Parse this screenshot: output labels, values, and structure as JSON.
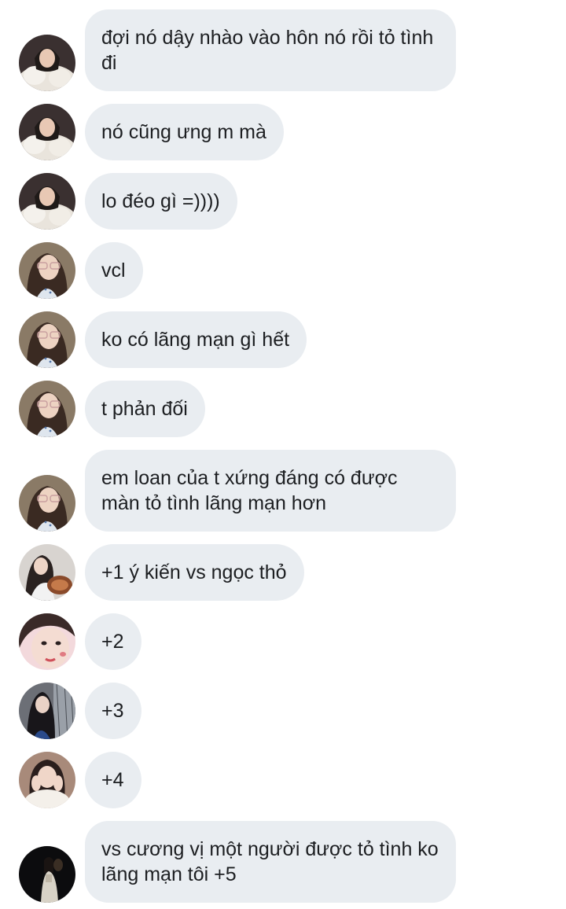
{
  "messages": [
    {
      "text": "đợi nó dậy nhào vào hôn nó rồi tỏ tình đi",
      "avatar": "user-a"
    },
    {
      "text": "nó cũng ưng m mà",
      "avatar": "user-a"
    },
    {
      "text": "lo đéo gì =))))",
      "avatar": "user-a"
    },
    {
      "text": "vcl",
      "avatar": "user-b"
    },
    {
      "text": "ko có lãng mạn gì hết",
      "avatar": "user-b"
    },
    {
      "text": "t phản đối",
      "avatar": "user-b"
    },
    {
      "text": "em loan của t xứng đáng có được màn tỏ tình lãng mạn hơn",
      "avatar": "user-b"
    },
    {
      "text": "+1 ý kiến vs ngọc thỏ",
      "avatar": "user-c"
    },
    {
      "text": "+2",
      "avatar": "user-d"
    },
    {
      "text": "+3",
      "avatar": "user-e"
    },
    {
      "text": "+4",
      "avatar": "user-f"
    },
    {
      "text": "vs cương vị một người được tỏ tình ko lãng mạn tôi +5",
      "avatar": "user-g"
    }
  ],
  "colors": {
    "bubble": "#e9edf1",
    "text": "#1c1e21",
    "background": "#ffffff"
  }
}
